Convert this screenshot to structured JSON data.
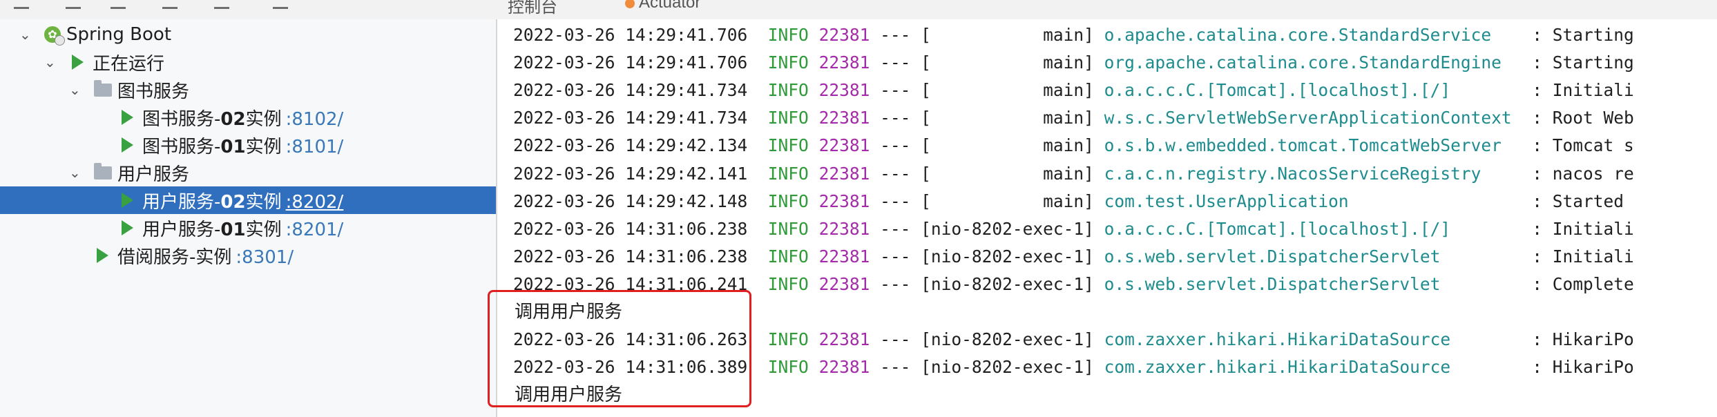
{
  "tabs": {
    "console": "控制台",
    "actuator": "Actuator"
  },
  "tree": [
    {
      "label": "Spring Boot",
      "kind": "root"
    },
    {
      "label": "正在运行",
      "kind": "group"
    },
    {
      "label": "图书服务",
      "kind": "folder"
    },
    {
      "name_a": "图书服务-",
      "name_b": "02",
      "name_c": "实例",
      "port": ":8102/",
      "kind": "app"
    },
    {
      "name_a": "图书服务-",
      "name_b": "01",
      "name_c": "实例",
      "port": ":8101/",
      "kind": "app"
    },
    {
      "label": "用户服务",
      "kind": "folder"
    },
    {
      "name_a": "用户服务-",
      "name_b": "02",
      "name_c": "实例",
      "port": ":8202/",
      "kind": "app",
      "selected": true
    },
    {
      "name_a": "用户服务-",
      "name_b": "01",
      "name_c": "实例",
      "port": ":8201/",
      "kind": "app"
    },
    {
      "name_a": "借阅服务-实例",
      "name_b": "",
      "name_c": "",
      "port": ":8301/",
      "kind": "app"
    }
  ],
  "log": [
    {
      "ts": "2022-03-26 14:29:41.706",
      "level": "INFO",
      "pid": "22381",
      "sep": "---",
      "thread": "[           main]",
      "logger": "o.apache.catalina.core.StandardService   ",
      "msg": ": Starting"
    },
    {
      "ts": "2022-03-26 14:29:41.706",
      "level": "INFO",
      "pid": "22381",
      "sep": "---",
      "thread": "[           main]",
      "logger": "org.apache.catalina.core.StandardEngine  ",
      "msg": ": Starting"
    },
    {
      "ts": "2022-03-26 14:29:41.734",
      "level": "INFO",
      "pid": "22381",
      "sep": "---",
      "thread": "[           main]",
      "logger": "o.a.c.c.C.[Tomcat].[localhost].[/]       ",
      "msg": ": Initiali"
    },
    {
      "ts": "2022-03-26 14:29:41.734",
      "level": "INFO",
      "pid": "22381",
      "sep": "---",
      "thread": "[           main]",
      "logger": "w.s.c.ServletWebServerApplicationContext ",
      "msg": ": Root Web"
    },
    {
      "ts": "2022-03-26 14:29:42.134",
      "level": "INFO",
      "pid": "22381",
      "sep": "---",
      "thread": "[           main]",
      "logger": "o.s.b.w.embedded.tomcat.TomcatWebServer  ",
      "msg": ": Tomcat s"
    },
    {
      "ts": "2022-03-26 14:29:42.141",
      "level": "INFO",
      "pid": "22381",
      "sep": "---",
      "thread": "[           main]",
      "logger": "c.a.c.n.registry.NacosServiceRegistry    ",
      "msg": ": nacos re"
    },
    {
      "ts": "2022-03-26 14:29:42.148",
      "level": "INFO",
      "pid": "22381",
      "sep": "---",
      "thread": "[           main]",
      "logger": "com.test.UserApplication                 ",
      "msg": ": Started "
    },
    {
      "ts": "2022-03-26 14:31:06.238",
      "level": "INFO",
      "pid": "22381",
      "sep": "---",
      "thread": "[nio-8202-exec-1]",
      "logger": "o.a.c.c.C.[Tomcat].[localhost].[/]       ",
      "msg": ": Initiali"
    },
    {
      "ts": "2022-03-26 14:31:06.238",
      "level": "INFO",
      "pid": "22381",
      "sep": "---",
      "thread": "[nio-8202-exec-1]",
      "logger": "o.s.web.servlet.DispatcherServlet        ",
      "msg": ": Initiali"
    },
    {
      "ts": "2022-03-26 14:31:06.241",
      "level": "INFO",
      "pid": "22381",
      "sep": "---",
      "thread": "[nio-8202-exec-1]",
      "logger": "o.s.web.servlet.DispatcherServlet        ",
      "msg": ": Complete"
    },
    {
      "plain": "调用用户服务"
    },
    {
      "ts": "2022-03-26 14:31:06.263",
      "level": "INFO",
      "pid": "22381",
      "sep": "---",
      "thread": "[nio-8202-exec-1]",
      "logger": "com.zaxxer.hikari.HikariDataSource       ",
      "msg": ": HikariPo"
    },
    {
      "ts": "2022-03-26 14:31:06.389",
      "level": "INFO",
      "pid": "22381",
      "sep": "---",
      "thread": "[nio-8202-exec-1]",
      "logger": "com.zaxxer.hikari.HikariDataSource       ",
      "msg": ": HikariPo"
    },
    {
      "plain": "调用用户服务"
    }
  ],
  "colors": {
    "info": "#2f9a38",
    "pid": "#a32ca8",
    "logger": "#1e8c8e",
    "selection": "#2f6fbd",
    "highlight_box": "#e02020"
  }
}
